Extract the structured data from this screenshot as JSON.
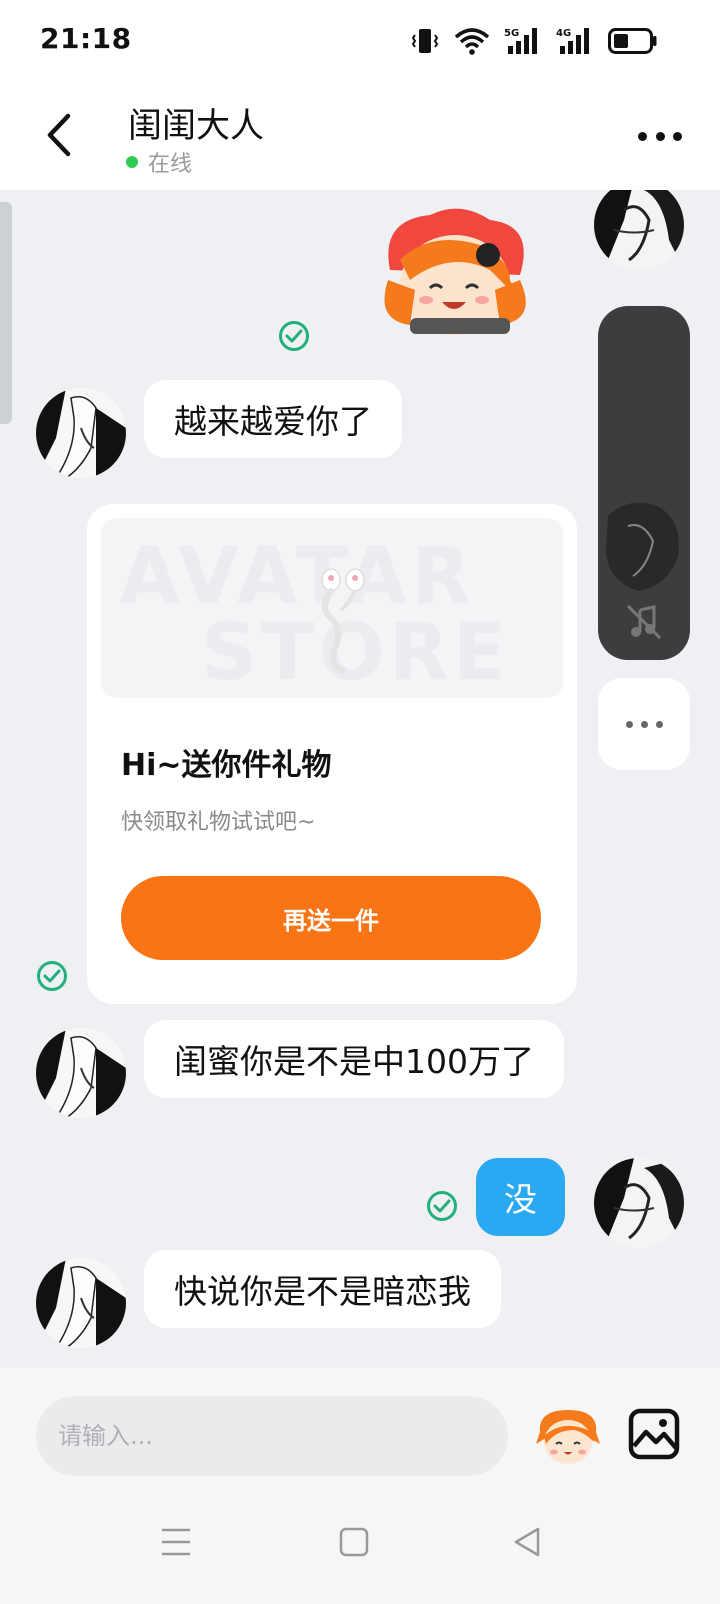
{
  "status_bar": {
    "time": "21:18",
    "icons": [
      "vibrate-icon",
      "wifi-icon",
      "signal-5g-icon",
      "signal-4g-icon",
      "battery-icon"
    ],
    "net1": "5G",
    "net2": "4G"
  },
  "header": {
    "title": "闺闺大人",
    "status": "在线",
    "status_color": "#2ecc55"
  },
  "messages": {
    "m1": "越来越爱你了",
    "m2": "闺蜜你是不是中100万了",
    "m3": "没",
    "m4": "快说你是不是暗恋我"
  },
  "gift_card": {
    "watermark_line1": "AVATAR",
    "watermark_line2": "STORE",
    "title": "Hi~送你件礼物",
    "subtitle": "快领取礼物试试吧~",
    "button_label": "再送一件",
    "button_color": "#f97414"
  },
  "input_bar": {
    "placeholder": "请输入..."
  },
  "colors": {
    "chat_bg": "#eef0f4",
    "my_bubble": "#2aa8f2",
    "check_green": "#22b07a"
  }
}
